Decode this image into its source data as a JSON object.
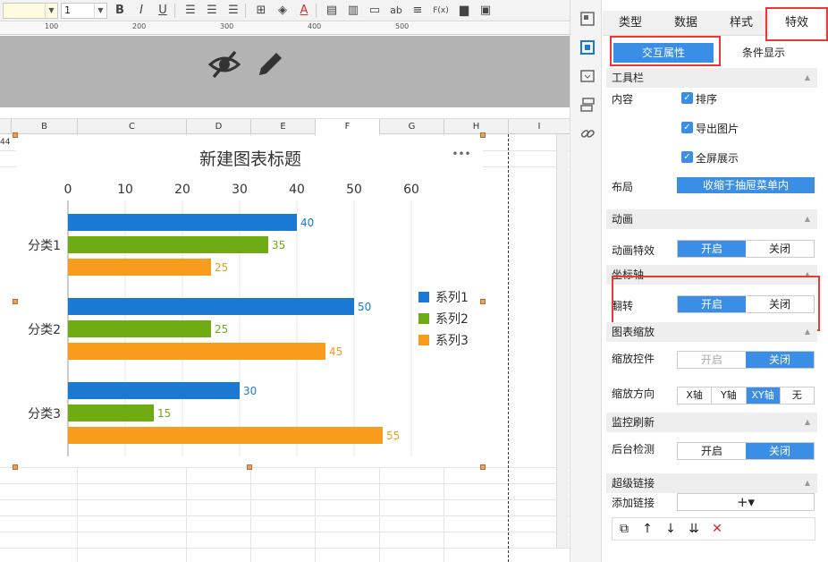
{
  "toolbar": {
    "font_size": "1",
    "buttons": [
      "B",
      "I",
      "U",
      "ab",
      "F(x)"
    ]
  },
  "ruler": {
    "ticks": [
      "100",
      "200",
      "300",
      "400",
      "500"
    ]
  },
  "columns": [
    "B",
    "C",
    "D",
    "E",
    "F",
    "G",
    "H",
    "I"
  ],
  "row_fragment": "44",
  "chart_data": {
    "type": "bar",
    "orientation": "horizontal",
    "title": "新建图表标题",
    "more_icon": "•••",
    "categories": [
      "分类1",
      "分类2",
      "分类3"
    ],
    "series": [
      {
        "name": "系列1",
        "values": [
          40,
          50,
          30
        ],
        "color": "#1979d3"
      },
      {
        "name": "系列2",
        "values": [
          35,
          25,
          15
        ],
        "color": "#6fab13"
      },
      {
        "name": "系列3",
        "values": [
          25,
          45,
          55
        ],
        "color": "#f99b1b"
      }
    ],
    "xlim": [
      0,
      60
    ],
    "ticks": [
      "0",
      "10",
      "20",
      "30",
      "40",
      "50",
      "60"
    ],
    "xaxis_position": "top",
    "grid": true,
    "legend": "right"
  },
  "panel": {
    "tabs": [
      "类型",
      "数据",
      "样式",
      "特效"
    ],
    "active_tab": "特效",
    "subtabs": [
      "交互属性",
      "条件显示"
    ],
    "toolbar_section": "工具栏",
    "content_label": "内容",
    "checks": [
      "排序",
      "导出图片",
      "全屏展示"
    ],
    "layout_label": "布局",
    "layout_value": "收缩于抽屉菜单内",
    "animation_section": "动画",
    "animation_label": "动画特效",
    "coord_section": "坐标轴",
    "flip_label": "翻转",
    "zoom_section": "图表缩放",
    "zoom_control_label": "缩放控件",
    "zoom_dir_label": "缩放方向",
    "zoom_dirs": [
      "X轴",
      "Y轴",
      "XY轴",
      "无"
    ],
    "monitor_section": "监控刷新",
    "bg_check_label": "后台检测",
    "on": "开启",
    "off": "关闭",
    "link_section": "超级链接",
    "add_link_label": "添加链接",
    "add_link_icon": "+▾"
  },
  "colors": {
    "accent": "#3a8ee6",
    "highlight": "#e83838"
  }
}
